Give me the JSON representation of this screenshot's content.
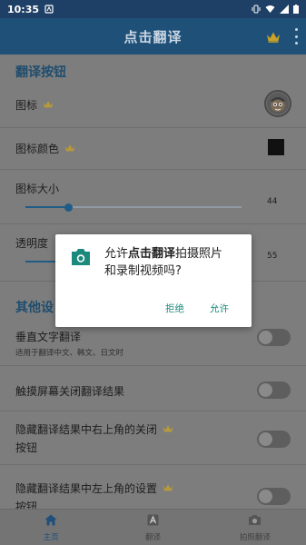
{
  "status_bar": {
    "time": "10:35"
  },
  "app_bar": {
    "title": "点击翻译"
  },
  "sections": {
    "button_header": "翻译按钮",
    "other_header": "其他设"
  },
  "rows": {
    "icon": {
      "label": "图标"
    },
    "icon_color": {
      "label": "图标颜色",
      "value": "#111111"
    },
    "icon_size": {
      "label": "图标大小",
      "value": "44",
      "level": 0.2
    },
    "opacity": {
      "label": "透明度",
      "value": "55",
      "level": 0.2
    },
    "vertical": {
      "label": "垂直文字翻译",
      "sub": "适用于翻译中文、韩文、日文时",
      "on": false
    },
    "touch_close": {
      "label": "触摸屏幕关闭翻译结果",
      "on": false
    },
    "hide_close": {
      "label_line1": "隐藏翻译结果中右上角的关闭",
      "label_line2": "按钮",
      "on": false
    },
    "hide_settings": {
      "label_line1": "隐藏翻译结果中左上角的设置",
      "label_line2": "按钮",
      "on": false
    }
  },
  "bottom_nav": [
    {
      "label": "主页",
      "active": true
    },
    {
      "label": "翻译",
      "active": false
    },
    {
      "label": "拍照翻译",
      "active": false
    }
  ],
  "dialog": {
    "prefix": "允许",
    "app_name": "点击翻译",
    "suffix_line1": "拍摄照片",
    "line2": "和录制视频吗?",
    "deny": "拒绝",
    "allow": "允许"
  },
  "colors": {
    "primary": "#1f5078",
    "accent_crown": "#c9a227",
    "dialog_button": "#1b8a7d"
  }
}
